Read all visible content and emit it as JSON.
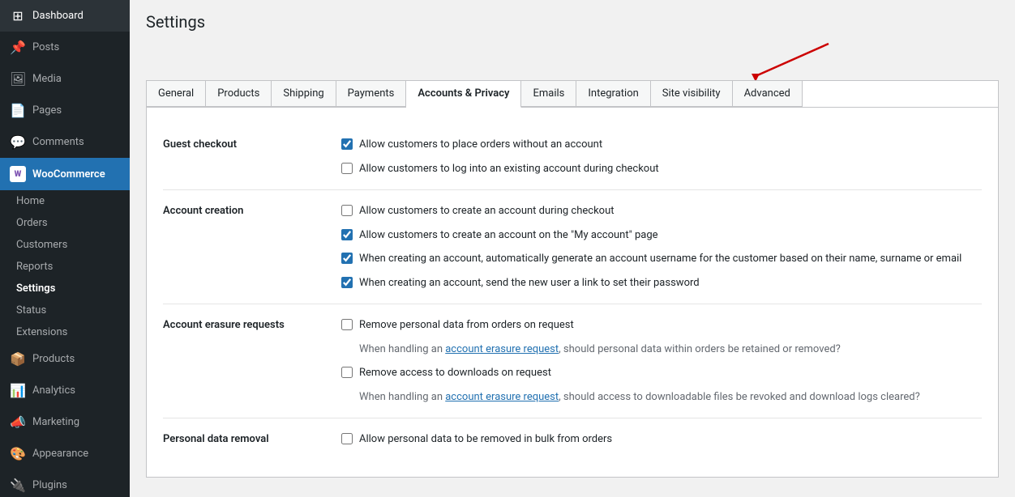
{
  "sidebar": {
    "top_items": [
      {
        "label": "Dashboard",
        "icon": "⊞",
        "name": "dashboard"
      },
      {
        "label": "Posts",
        "icon": "📌",
        "name": "posts"
      },
      {
        "label": "Media",
        "icon": "🖼",
        "name": "media"
      },
      {
        "label": "Pages",
        "icon": "📄",
        "name": "pages"
      },
      {
        "label": "Comments",
        "icon": "💬",
        "name": "comments"
      }
    ],
    "woocommerce": {
      "label": "WooCommerce",
      "icon": "W",
      "sub_items": [
        {
          "label": "Home",
          "name": "woo-home"
        },
        {
          "label": "Orders",
          "name": "woo-orders"
        },
        {
          "label": "Customers",
          "name": "woo-customers"
        },
        {
          "label": "Reports",
          "name": "woo-reports"
        },
        {
          "label": "Settings",
          "name": "woo-settings",
          "active": true
        },
        {
          "label": "Status",
          "name": "woo-status"
        },
        {
          "label": "Extensions",
          "name": "woo-extensions"
        }
      ]
    },
    "bottom_sections": [
      {
        "label": "Products",
        "icon": "📦",
        "name": "products"
      },
      {
        "label": "Analytics",
        "icon": "📊",
        "name": "analytics"
      },
      {
        "label": "Marketing",
        "icon": "📣",
        "name": "marketing"
      },
      {
        "label": "Appearance",
        "icon": "🎨",
        "name": "appearance"
      },
      {
        "label": "Plugins",
        "icon": "🔌",
        "name": "plugins"
      }
    ]
  },
  "page": {
    "title": "Settings"
  },
  "tabs": [
    {
      "label": "General",
      "name": "tab-general",
      "active": false
    },
    {
      "label": "Products",
      "name": "tab-products",
      "active": false
    },
    {
      "label": "Shipping",
      "name": "tab-shipping",
      "active": false
    },
    {
      "label": "Payments",
      "name": "tab-payments",
      "active": false
    },
    {
      "label": "Accounts & Privacy",
      "name": "tab-accounts-privacy",
      "active": true
    },
    {
      "label": "Emails",
      "name": "tab-emails",
      "active": false
    },
    {
      "label": "Integration",
      "name": "tab-integration",
      "active": false
    },
    {
      "label": "Site visibility",
      "name": "tab-site-visibility",
      "active": false
    },
    {
      "label": "Advanced",
      "name": "tab-advanced",
      "active": false
    }
  ],
  "sections": [
    {
      "name": "guest-checkout",
      "label": "Guest checkout",
      "controls": [
        {
          "type": "checkbox",
          "checked": true,
          "label": "Allow customers to place orders without an account",
          "name": "allow-orders-without-account"
        },
        {
          "type": "checkbox",
          "checked": false,
          "label": "Allow customers to log into an existing account during checkout",
          "name": "allow-login-during-checkout"
        }
      ]
    },
    {
      "name": "account-creation",
      "label": "Account creation",
      "controls": [
        {
          "type": "checkbox",
          "checked": false,
          "label": "Allow customers to create an account during checkout",
          "name": "create-account-checkout"
        },
        {
          "type": "checkbox",
          "checked": true,
          "label": "Allow customers to create an account on the \"My account\" page",
          "name": "create-account-my-account"
        },
        {
          "type": "checkbox",
          "checked": true,
          "label": "When creating an account, automatically generate an account username for the customer based on their name, surname or email",
          "name": "auto-generate-username"
        },
        {
          "type": "checkbox",
          "checked": true,
          "label": "When creating an account, send the new user a link to set their password",
          "name": "send-password-link"
        }
      ]
    },
    {
      "name": "account-erasure",
      "label": "Account erasure requests",
      "controls": [
        {
          "type": "checkbox",
          "checked": false,
          "label": "Remove personal data from orders on request",
          "name": "remove-personal-data-orders"
        },
        {
          "type": "help",
          "text_before": "When handling an ",
          "link_text": "account erasure request",
          "text_after": ", should personal data within orders be retained or removed?",
          "name": "help-erasure-orders"
        },
        {
          "type": "checkbox",
          "checked": false,
          "label": "Remove access to downloads on request",
          "name": "remove-downloads-access"
        },
        {
          "type": "help",
          "text_before": "When handling an ",
          "link_text": "account erasure request",
          "text_after": ", should access to downloadable files be revoked and download logs cleared?",
          "name": "help-erasure-downloads"
        }
      ]
    },
    {
      "name": "personal-data-removal",
      "label": "Personal data removal",
      "controls": [
        {
          "type": "checkbox",
          "checked": false,
          "label": "Allow personal data to be removed in bulk from orders",
          "name": "bulk-remove-personal-data"
        }
      ]
    }
  ]
}
